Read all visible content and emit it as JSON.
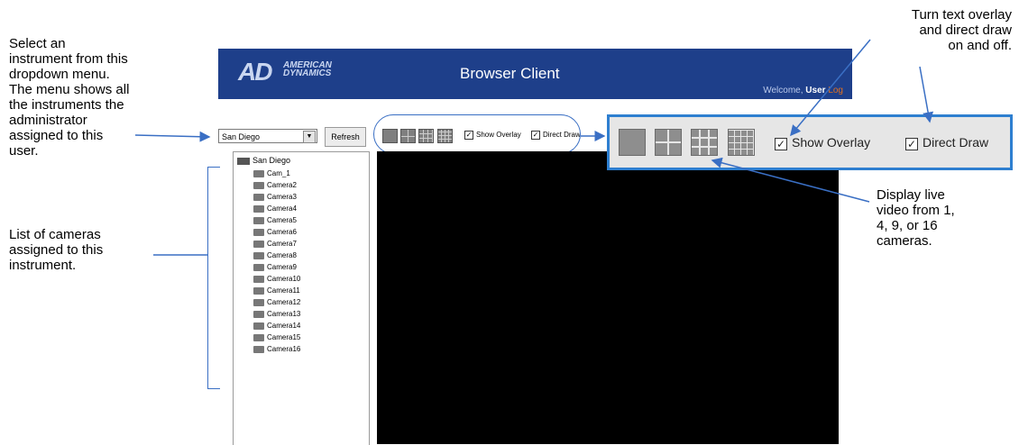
{
  "callouts": {
    "dropdown": "Select an\ninstrument from this\ndropdown menu.\nThe menu shows all\nthe instruments the\nadministrator\nassigned to this\nuser.",
    "camera_list": "List of cameras\nassigned to this\ninstrument.",
    "overlay": "Turn text overlay\nand direct draw\non and off.",
    "display": "Display live\nvideo from 1,\n4, 9, or 16\ncameras."
  },
  "header": {
    "logo_mark": "AD",
    "logo_text_1": "AMERICAN",
    "logo_text_2": "DYNAMICS",
    "title": "Browser Client",
    "welcome": "Welcome,",
    "user": "User",
    "logout": "Log"
  },
  "toolbar": {
    "instrument_selected": "San Diego",
    "refresh_label": "Refresh",
    "show_overlay_label": "Show Overlay",
    "direct_draw_label": "Direct Draw",
    "show_overlay_checked": true,
    "direct_draw_checked": true
  },
  "tree": {
    "root": "San Diego",
    "cameras": [
      "Cam_1",
      "Camera2",
      "Camera3",
      "Camera4",
      "Camera5",
      "Camera6",
      "Camera7",
      "Camera8",
      "Camera9",
      "Camera10",
      "Camera11",
      "Camera12",
      "Camera13",
      "Camera14",
      "Camera15",
      "Camera16"
    ]
  },
  "zoom": {
    "show_overlay_label": "Show Overlay",
    "direct_draw_label": "Direct Draw"
  },
  "colors": {
    "header_bg": "#1e3f8a",
    "callout_line": "#3a6fc4",
    "zoom_border": "#2e7fd0"
  }
}
